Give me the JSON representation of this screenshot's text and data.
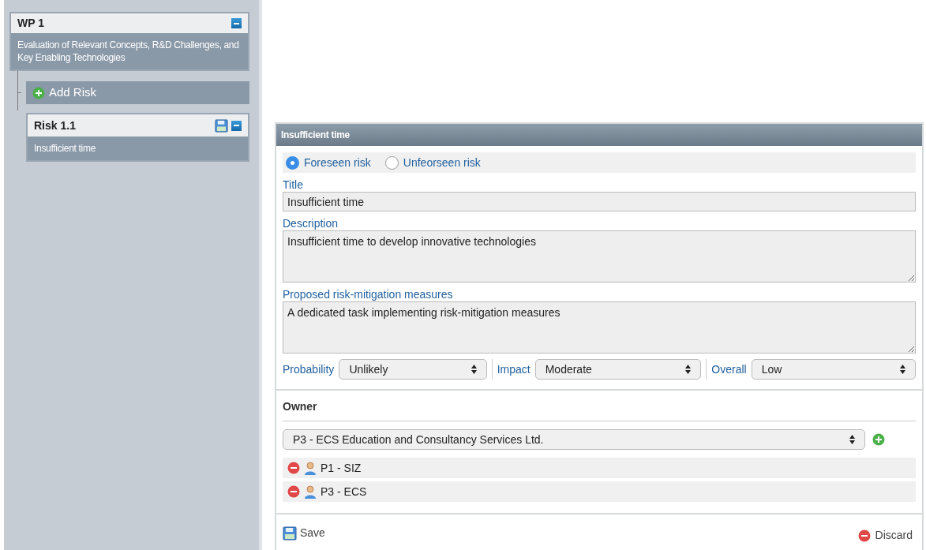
{
  "sidebar": {
    "work_package": {
      "title": "WP 1",
      "description": "Evaluation of Relevant Concepts, R&D Challenges, and Key Enabling Technologies",
      "expanded": true
    },
    "add_risk": "Add Risk",
    "risks": [
      {
        "title": "Risk 1.1",
        "subtitle": "Insufficient time",
        "expanded": true
      }
    ]
  },
  "form": {
    "header": "Insufficient time",
    "risk_types": [
      {
        "label": "Foreseen risk",
        "selected": true
      },
      {
        "label": "Unfeorseen risk",
        "selected": false
      }
    ],
    "fields": [
      {
        "kind": "input",
        "label": "Title",
        "value": "Insufficient time"
      },
      {
        "kind": "textarea",
        "label": "Description",
        "value": "Insufficient time to develop innovative technologies"
      },
      {
        "kind": "textarea",
        "label": "Proposed risk-mitigation measures",
        "value": "A dedicated task implementing risk-mitigation measures"
      }
    ],
    "ratings": [
      {
        "label": "Probability",
        "value": "Unlikely"
      },
      {
        "label": "Impact",
        "value": "Moderate"
      },
      {
        "label": "Overall",
        "value": "Low"
      }
    ],
    "owner": {
      "heading": "Owner",
      "select": "P3 - ECS Education and Consultancy Services Ltd.",
      "owners": [
        "P1 - SIZ",
        "P3 - ECS"
      ]
    },
    "save": "Save",
    "discard": "Discard"
  }
}
